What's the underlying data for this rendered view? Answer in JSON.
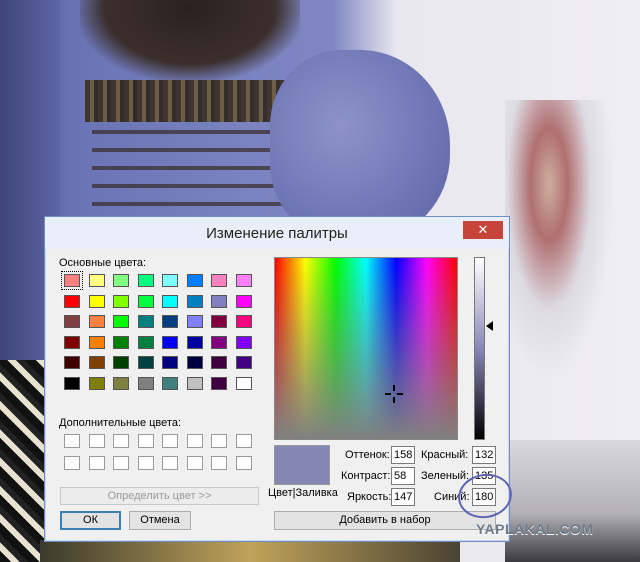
{
  "dialog": {
    "title": "Изменение палитры",
    "close_symbol": "✕",
    "basic_colors_label": "Основные цвета:",
    "custom_colors_label": "Дополнительные цвета:",
    "define_button": "Определить цвет >>",
    "ok_button": "ОК",
    "cancel_button": "Отмена",
    "color_fill_label": "Цвет|Заливка",
    "add_button": "Добавить в набор",
    "fields": {
      "hue": {
        "label": "Оттенок:",
        "value": "158"
      },
      "sat": {
        "label": "Контраст:",
        "value": "58"
      },
      "lum": {
        "label": "Яркость:",
        "value": "147"
      },
      "red": {
        "label": "Красный:",
        "value": "132"
      },
      "green": {
        "label": "Зеленый:",
        "value": "135"
      },
      "blue": {
        "label": "Синий:",
        "value": "180"
      }
    },
    "current_color": "#8487b4",
    "basic_colors": [
      [
        "#ff8080",
        "#ffff80",
        "#80ff80",
        "#00ff80",
        "#80ffff",
        "#0080ff",
        "#ff80c0",
        "#ff80ff"
      ],
      [
        "#ff0000",
        "#ffff00",
        "#80ff00",
        "#00ff40",
        "#00ffff",
        "#0080c0",
        "#8080c0",
        "#ff00ff"
      ],
      [
        "#804040",
        "#ff8040",
        "#00ff00",
        "#008080",
        "#004080",
        "#8080ff",
        "#800040",
        "#ff0080"
      ],
      [
        "#800000",
        "#ff8000",
        "#008000",
        "#008040",
        "#0000ff",
        "#0000a0",
        "#800080",
        "#8000ff"
      ],
      [
        "#400000",
        "#804000",
        "#004000",
        "#004040",
        "#000080",
        "#000040",
        "#400040",
        "#400080"
      ],
      [
        "#000000",
        "#808000",
        "#808040",
        "#808080",
        "#408080",
        "#c0c0c0",
        "#400040",
        "#ffffff"
      ]
    ]
  },
  "watermark": "YAPLAKAL.COM"
}
